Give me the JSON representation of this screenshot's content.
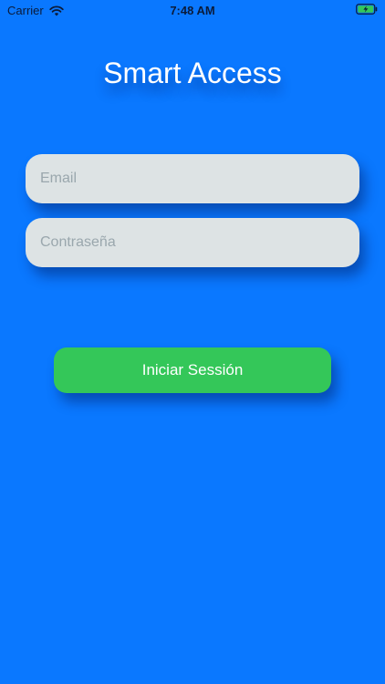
{
  "status_bar": {
    "carrier": "Carrier",
    "time": "7:48 AM",
    "wifi_icon": "wifi-icon",
    "battery_icon": "battery-charging-icon"
  },
  "app": {
    "title": "Smart Access"
  },
  "form": {
    "email_placeholder": "Email",
    "email_value": "",
    "password_placeholder": "Contraseña",
    "password_value": "",
    "login_label": "Iniciar Sessión"
  },
  "colors": {
    "background": "#0a78ff",
    "field_bg": "#dde3e4",
    "button_bg": "#34c759",
    "title_text": "#ffffff"
  }
}
